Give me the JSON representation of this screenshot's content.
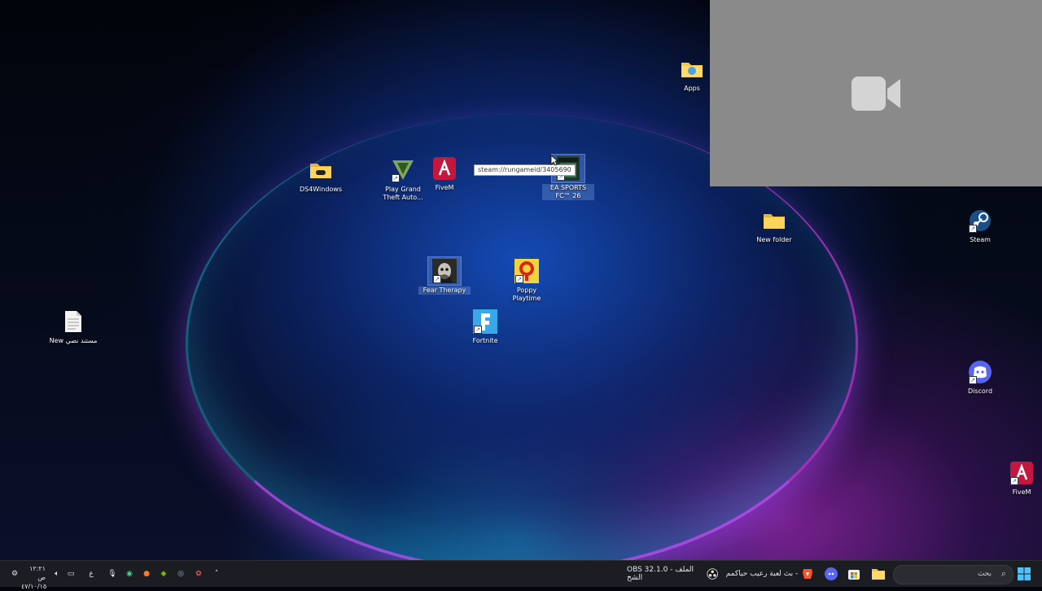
{
  "desktop": {
    "icons": [
      {
        "id": "apps",
        "label": "Apps",
        "icon": "folder-apps-icon"
      },
      {
        "id": "ds4windows",
        "label": "DS4Windows",
        "icon": "folder-gamepad-icon"
      },
      {
        "id": "gta",
        "label": "Play Grand Theft Auto...",
        "icon": "gta-v-icon"
      },
      {
        "id": "fivem",
        "label": "FiveM",
        "icon": "fivem-icon"
      },
      {
        "id": "easports",
        "label": "EA SPORTS FC™ 26",
        "icon": "ea-sports-fc-icon"
      },
      {
        "id": "newfolder",
        "label": "New folder",
        "icon": "folder-icon"
      },
      {
        "id": "steam",
        "label": "Steam",
        "icon": "steam-icon"
      },
      {
        "id": "feartherapy",
        "label": "Fear Therapy",
        "icon": "fear-therapy-icon"
      },
      {
        "id": "poppy",
        "label": "Poppy Playtime",
        "icon": "poppy-playtime-icon"
      },
      {
        "id": "fortnite",
        "label": "Fortnite",
        "icon": "fortnite-icon"
      },
      {
        "id": "newtext",
        "label": "New مستند نصي",
        "icon": "text-document-icon"
      },
      {
        "id": "discord",
        "label": "Discord",
        "icon": "discord-icon"
      },
      {
        "id": "fivem2",
        "label": "FiveM",
        "icon": "fivem-icon"
      }
    ],
    "tooltip": "steam://rungameid/3405690"
  },
  "video_panel": {
    "icon": "video-camera-icon"
  },
  "taskbar": {
    "search_placeholder": "بحث",
    "brave_window": "بث لعبة رعيب حياكمم -",
    "obs_window": "OBS 32.1.0 - الملف الشخ",
    "clock_time": "١٢:٢١ ص",
    "clock_date": "٤٧/١٠/١٥",
    "language": "ع",
    "colors": {
      "taskbar": "#1c1d22",
      "accent": "#1b5fd6"
    }
  }
}
